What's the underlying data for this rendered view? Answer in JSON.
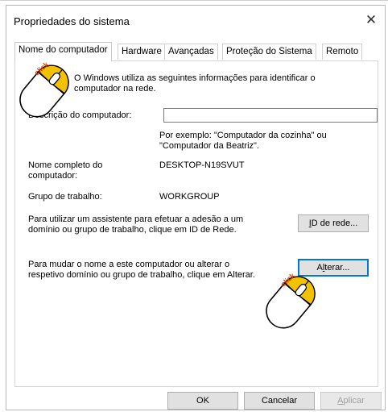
{
  "window": {
    "title": "Propriedades do sistema",
    "close_glyph": "✕"
  },
  "tabs": [
    {
      "label": "Nome do computador",
      "active": true
    },
    {
      "label": "Hardware",
      "active": false
    },
    {
      "label": "Avançadas",
      "active": false
    },
    {
      "label": "Proteção do Sistema",
      "active": false
    },
    {
      "label": "Remoto",
      "active": false
    }
  ],
  "panel": {
    "intro_line1": "O Windows utiliza as seguintes informações para identificar o",
    "intro_line2": "computador na rede.",
    "description_label": "Descrição do computador:",
    "description_value": "",
    "example_line1": "Por exemplo: \"Computador da cozinha\" ou",
    "example_line2": "\"Computador da Beatriz\".",
    "fullname_label_line1": "Nome completo do",
    "fullname_label_line2": "computador:",
    "fullname_value": "DESKTOP-N19SVUT",
    "workgroup_label": "Grupo de trabalho:",
    "workgroup_value": "WORKGROUP",
    "network_id_text_line1": "Para utilizar um assistente para efetuar a adesão a um",
    "network_id_text_line2": "domínio ou grupo de trabalho, clique em ID de Rede.",
    "network_id_button_prefix": "I",
    "network_id_button_rest": "D de rede...",
    "rename_text_line1": "Para mudar o nome a este computador ou alterar o",
    "rename_text_line2": "respetivo domínio ou grupo de trabalho, clique em Alterar.",
    "change_button_prefix": "A",
    "change_button_u": "l",
    "change_button_rest": "terar..."
  },
  "footer": {
    "ok_label": "OK",
    "cancel_label": "Cancelar",
    "apply_prefix": "A",
    "apply_rest": "plicar"
  },
  "overlays": {
    "click_label": "click",
    "mouse_color": "#f2c200",
    "click_color": "#e03a00"
  }
}
